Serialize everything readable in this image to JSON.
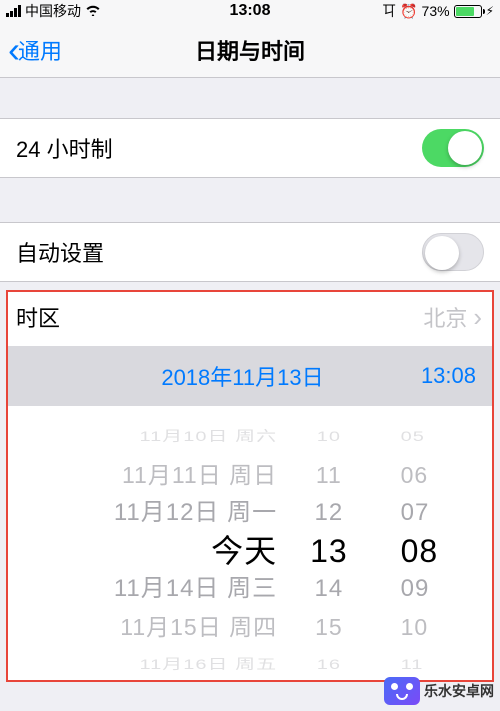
{
  "status": {
    "carrier": "中国移动",
    "time": "13:08",
    "battery_pct": "73%"
  },
  "nav": {
    "back_label": "通用",
    "title": "日期与时间"
  },
  "rows": {
    "hour24_label": "24 小时制",
    "auto_label": "自动设置",
    "timezone_label": "时区",
    "timezone_value": "北京"
  },
  "selected": {
    "date": "2018年11月13日",
    "time": "13:08"
  },
  "picker": {
    "date": [
      "11月10日 周六",
      "11月11日 周日",
      "11月12日 周一",
      "今天",
      "11月14日 周三",
      "11月15日 周四",
      "11月16日 周五"
    ],
    "hour": [
      "10",
      "11",
      "12",
      "13",
      "14",
      "15",
      "16"
    ],
    "min": [
      "05",
      "06",
      "07",
      "08",
      "09",
      "10",
      "11"
    ]
  },
  "watermark": "乐水安卓网"
}
